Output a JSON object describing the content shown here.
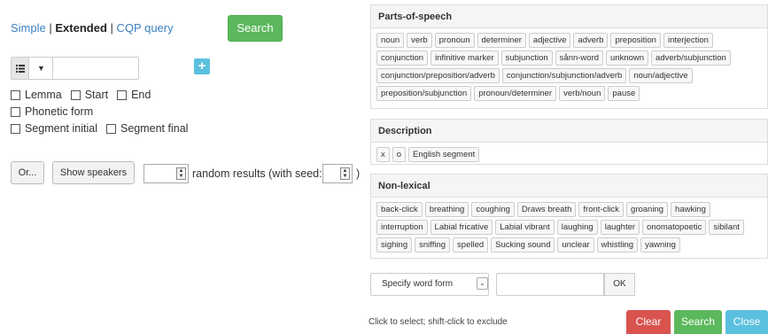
{
  "search": {
    "modes": {
      "simple": "Simple",
      "separator": "|",
      "extended": "Extended",
      "cqp": "CQP query"
    },
    "search_button": "Search",
    "token_menu_icon": "list-icon",
    "add_token_icon": "plus-icon",
    "checkboxes": {
      "lemma": "Lemma",
      "start": "Start",
      "end": "End",
      "phonetic": "Phonetic form",
      "segment_initial": "Segment initial",
      "segment_final": "Segment final"
    },
    "or_button": "Or...",
    "show_speakers": "Show speakers",
    "random_label": "random results (with seed:",
    "close_paren": ")"
  },
  "filters": {
    "pos": {
      "title": "Parts-of-speech",
      "tags": [
        "noun",
        "verb",
        "pronoun",
        "determiner",
        "adjective",
        "adverb",
        "preposition",
        "interjection",
        "conjunction",
        "infinitive marker",
        "subjunction",
        "sånn-word",
        "unknown",
        "adverb/subjunction",
        "conjunction/preposition/adverb",
        "conjunction/subjunction/adverb",
        "noun/adjective",
        "preposition/subjunction",
        "pronoun/determiner",
        "verb/noun",
        "pause"
      ]
    },
    "description": {
      "title": "Description",
      "tags": [
        "x",
        "o",
        "English segment"
      ]
    },
    "nonlexical": {
      "title": "Non-lexical",
      "tags": [
        "back-click",
        "breathing",
        "coughing",
        "Draws breath",
        "front-click",
        "groaning",
        "hawking",
        "interruption",
        "Labial fricative",
        "Labial vibrant",
        "laughing",
        "laughter",
        "onomatopoetic",
        "sibilant",
        "sighing",
        "sniffing",
        "spelled",
        "Sucking sound",
        "unclear",
        "whistling",
        "yawning"
      ]
    },
    "word_form": {
      "placeholder": "Specify word form",
      "ok": "OK"
    },
    "hint": "Click to select; shift-click to exclude",
    "buttons": {
      "clear": "Clear",
      "search": "Search",
      "close": "Close"
    }
  },
  "colors": {
    "success": "#5cb85c",
    "danger": "#d9534f",
    "info": "#5bc0de",
    "link": "#3a7fc1"
  }
}
